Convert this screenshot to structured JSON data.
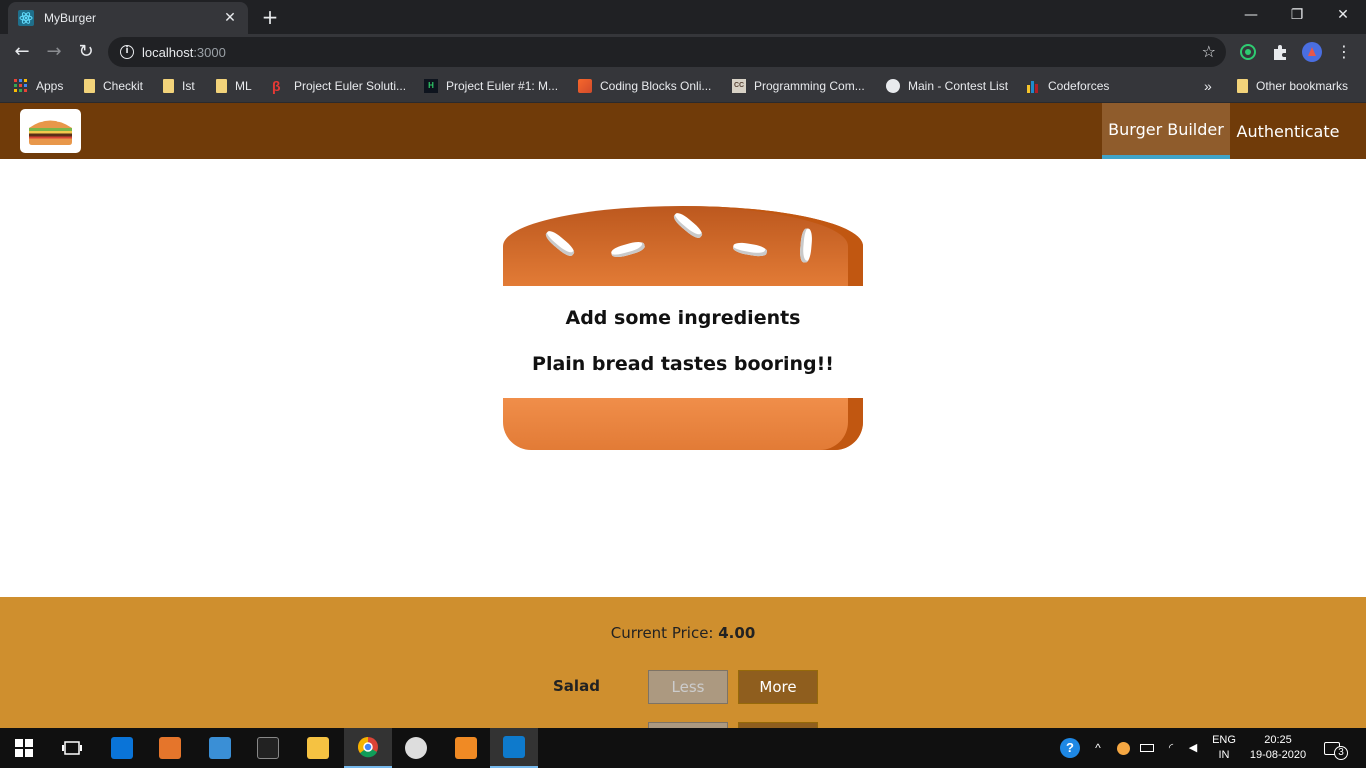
{
  "browser": {
    "tab_title": "MyBurger",
    "tab_close": "✕",
    "new_tab": "+",
    "window_controls": {
      "minimize": "—",
      "restore": "❐",
      "close": "✕"
    },
    "nav": {
      "back": "←",
      "forward": "→",
      "reload": "↻"
    },
    "url_host": "localhost",
    "url_port": ":3000",
    "star": "☆",
    "bookmarks": [
      {
        "label": "Apps",
        "icon": "apps-grid-icon"
      },
      {
        "label": "Checkit",
        "icon": "folder-icon"
      },
      {
        "label": "Ist",
        "icon": "folder-icon"
      },
      {
        "label": "ML",
        "icon": "folder-icon"
      },
      {
        "label": "Project Euler Soluti...",
        "icon": "beta-icon"
      },
      {
        "label": "Project Euler #1: M...",
        "icon": "hackerrank-icon"
      },
      {
        "label": "Coding Blocks Onli...",
        "icon": "coding-blocks-icon"
      },
      {
        "label": "Programming Com...",
        "icon": "codechef-icon"
      },
      {
        "label": "Main - Contest List",
        "icon": "globe-icon"
      },
      {
        "label": "Codeforces",
        "icon": "codeforces-icon"
      }
    ],
    "bookmarks_overflow": "»",
    "other_bookmarks": "Other bookmarks"
  },
  "app": {
    "nav": [
      {
        "label": "Burger Builder",
        "active": true
      },
      {
        "label": "Authenticate",
        "active": false
      }
    ],
    "burger": {
      "message_line1": "Add some ingredients",
      "message_line2": "Plain bread tastes booring!!"
    },
    "controls": {
      "price_label": "Current Price: ",
      "price_value": "4.00",
      "rows": [
        {
          "label": "Salad",
          "less": "Less",
          "more": "More"
        }
      ]
    }
  },
  "taskbar": {
    "lang_top": "ENG",
    "lang_bottom": "IN",
    "time": "20:25",
    "date": "19-08-2020",
    "notifications": "3"
  },
  "colors": {
    "header": "#703b09",
    "controls_bg": "#cf8f2e",
    "active_nav_border": "#40a4c8"
  }
}
